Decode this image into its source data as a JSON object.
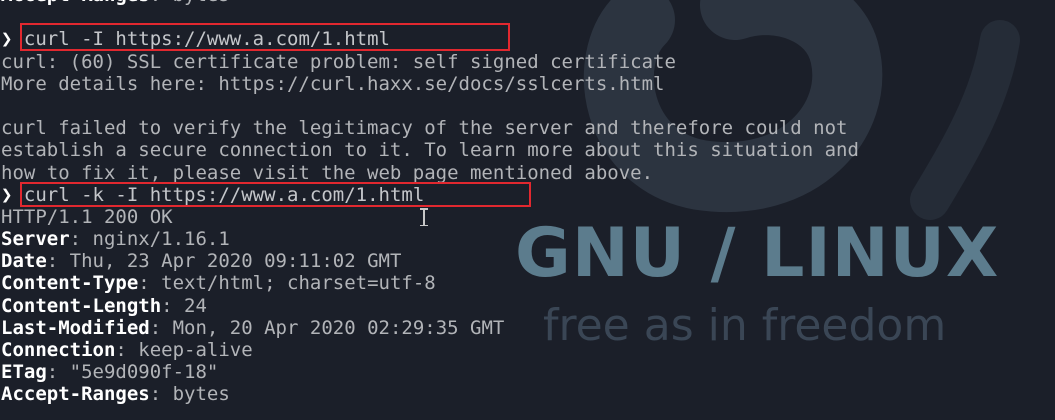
{
  "colors": {
    "background": "#1b1f29",
    "text": "#b2b4b8",
    "header_key": "#ffffff",
    "highlight_border": "#e2282f",
    "brand": "#5c7c8d"
  },
  "wallpaper": {
    "title": "GNU / LINUX",
    "tagline": "free as in freedom",
    "icon": "debian-swirl-icon"
  },
  "terminal": {
    "prompt_symbol": "❯",
    "lines": [
      {
        "key": "Accept-Ranges",
        "sep": ": ",
        "value": "bytes"
      },
      {
        "text": ""
      },
      {
        "cmd": "curl -I https://www.a.com/1.html"
      },
      {
        "text": "curl: (60) SSL certificate problem: self signed certificate"
      },
      {
        "text": "More details here: https://curl.haxx.se/docs/sslcerts.html"
      },
      {
        "text": ""
      },
      {
        "text": "curl failed to verify the legitimacy of the server and therefore could not"
      },
      {
        "text": "establish a secure connection to it. To learn more about this situation and"
      },
      {
        "text": "how to fix it, please visit the web page mentioned above."
      },
      {
        "cmd": "curl -k -I https://www.a.com/1.html"
      },
      {
        "text": "HTTP/1.1 200 OK"
      },
      {
        "key": "Server",
        "sep": ": ",
        "value": "nginx/1.16.1"
      },
      {
        "key": "Date",
        "sep": ": ",
        "value": "Thu, 23 Apr 2020 09:11:02 GMT"
      },
      {
        "key": "Content-Type",
        "sep": ": ",
        "value": "text/html; charset=utf-8"
      },
      {
        "key": "Content-Length",
        "sep": ": ",
        "value": "24"
      },
      {
        "key": "Last-Modified",
        "sep": ": ",
        "value": "Mon, 20 Apr 2020 02:29:35 GMT"
      },
      {
        "key": "Connection",
        "sep": ": ",
        "value": "keep-alive"
      },
      {
        "key": "ETag",
        "sep": ": ",
        "value": "\"5e9d090f-18\""
      },
      {
        "key": "Accept-Ranges",
        "sep": ": ",
        "value": "bytes"
      }
    ]
  }
}
